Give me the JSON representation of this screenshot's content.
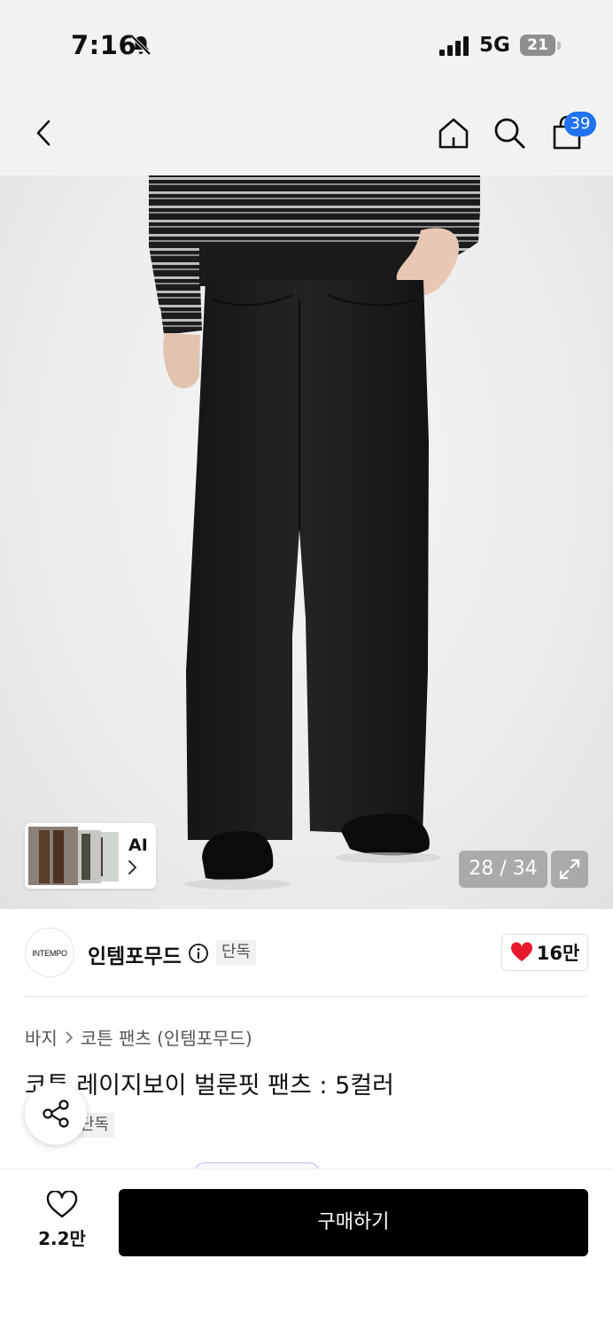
{
  "status_bar": {
    "time": "7:16",
    "network": "5G",
    "battery": "21"
  },
  "nav": {
    "cart_count": "39"
  },
  "gallery": {
    "ai_label": "AI",
    "counter": "28 / 34",
    "accent": "#1f73f0"
  },
  "brand": {
    "logo_text": "INTEMPO",
    "name": "인템포무드",
    "exclusive_badge": "단독",
    "like_count": "16만",
    "heart_color": "#e8192c"
  },
  "product": {
    "breadcrumb": {
      "category": "바지",
      "subcategory": "코튼 팬츠 (인템포무드)"
    },
    "title": "코튼 레이지보이 벌룬핏 팬츠 : 5컬러",
    "exclusive_badge": "단독"
  },
  "bottom_bar": {
    "wish_count": "2.2만",
    "buy_label": "구매하기"
  }
}
